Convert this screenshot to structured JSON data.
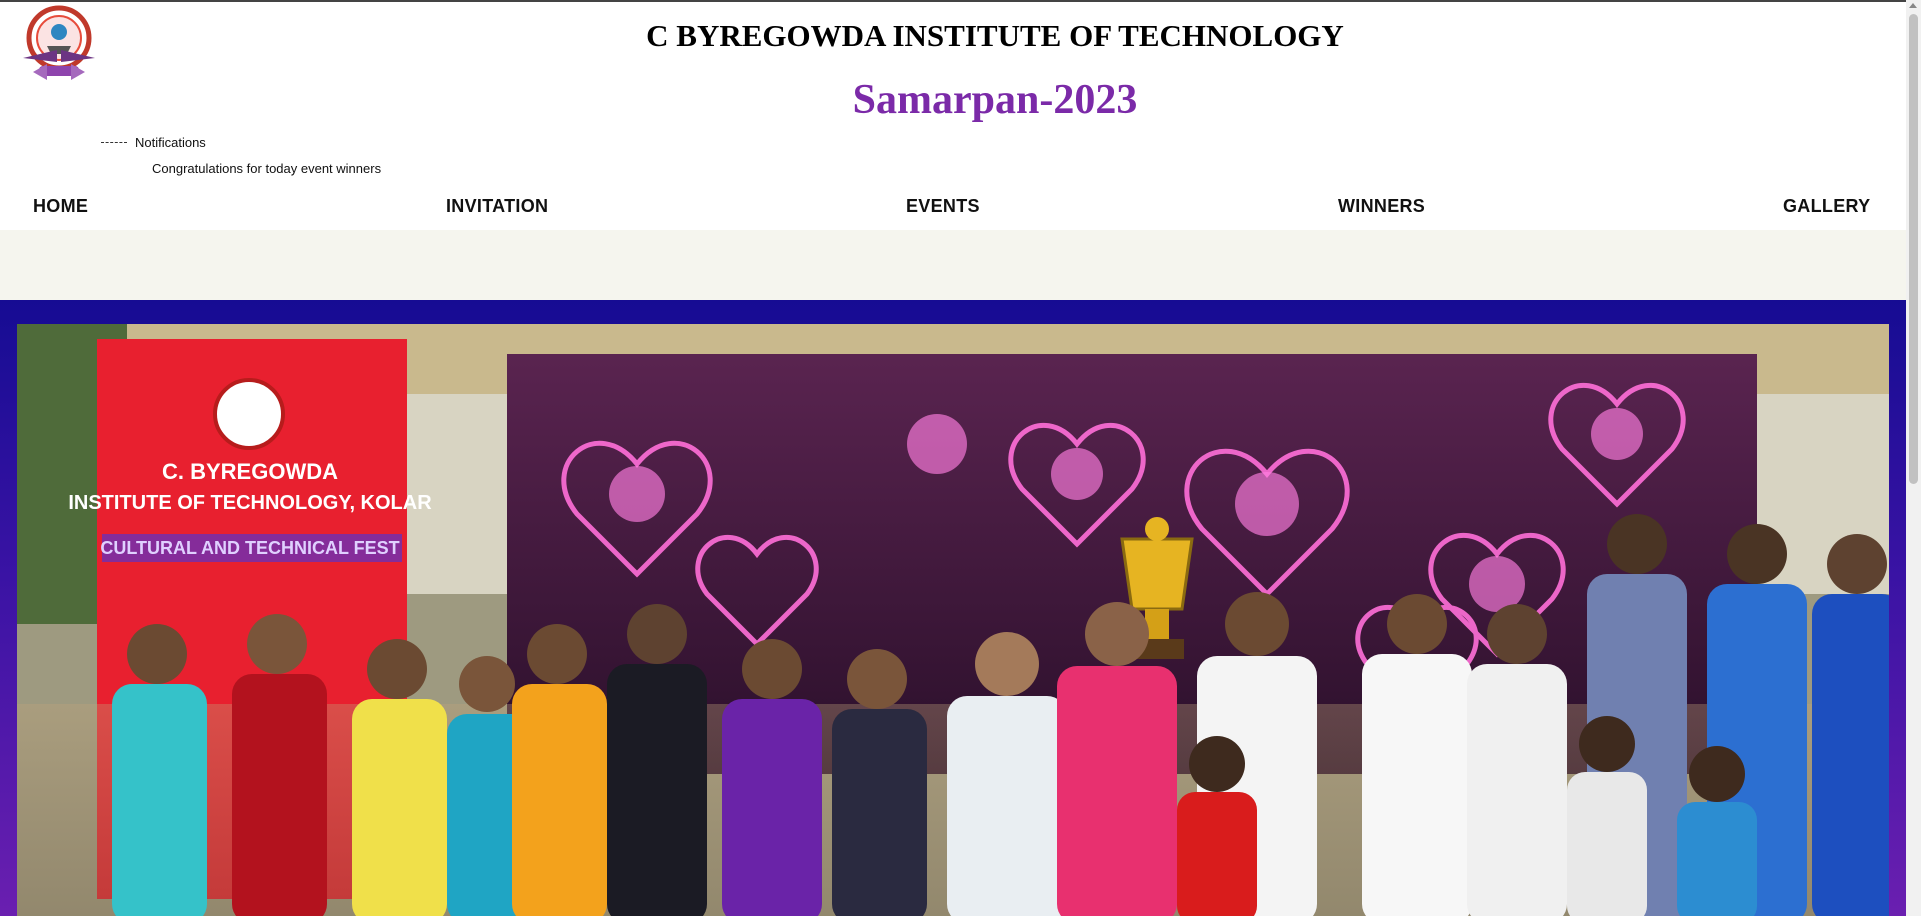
{
  "header": {
    "institute_title": "C BYREGOWDA INSTITUTE OF TECHNOLOGY",
    "event_title": "Samarpan-2023",
    "logo_icon": "college-emblem-icon"
  },
  "notifications": {
    "label": "Notifications",
    "message": "Congratulations for today event winners"
  },
  "nav": {
    "items": [
      {
        "label": "HOME"
      },
      {
        "label": "INVITATION"
      },
      {
        "label": "EVENTS"
      },
      {
        "label": "WINNERS"
      },
      {
        "label": "GALLERY"
      }
    ]
  },
  "banner": {
    "text_line1": "C. BYREGOWDA",
    "text_line2": "INSTITUTE OF TECHNOLOGY, KOLAR",
    "text_line3": "CULTURAL AND TECHNICAL FEST"
  },
  "colors": {
    "accent": "#7b2aa8",
    "hero_bg": "#160c93",
    "band_bg": "#f5f5ee"
  }
}
